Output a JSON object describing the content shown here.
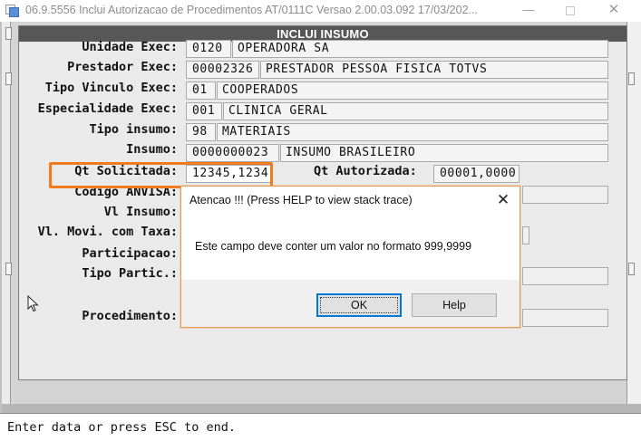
{
  "window": {
    "title": "06.9.5556    Inclui  Autorizacao de Procedimentos AT/0111C Versao 2.00.03.092 17/03/202...",
    "minimize_glyph": "—",
    "close_glyph": "✕",
    "icon": "app-window-icon"
  },
  "panel": {
    "header": "INCLUI INSUMO"
  },
  "form": {
    "unidade_exec": {
      "label": "Unidade Exec:",
      "code": "0120",
      "desc": "OPERADORA SA"
    },
    "prestador_exec": {
      "label": "Prestador Exec:",
      "code": "00002326",
      "desc": "PRESTADOR PESSOA FISICA TOTVS"
    },
    "tipo_vinculo_exec": {
      "label": "Tipo Vinculo Exec:",
      "code": "01",
      "desc": "COOPERADOS"
    },
    "especialidade_exec": {
      "label": "Especialidade Exec:",
      "code": "001",
      "desc": "CLINICA GERAL"
    },
    "tipo_insumo": {
      "label": "Tipo insumo:",
      "code": "98",
      "desc": "MATERIAIS"
    },
    "insumo": {
      "label": "Insumo:",
      "code": "0000000023",
      "desc": "INSUMO BRASILEIRO"
    },
    "qt_solicitada": {
      "label": "Qt Solicitada:",
      "value": "12345,1234"
    },
    "qt_autorizada": {
      "label": "Qt Autorizada:",
      "value": "00001,0000"
    },
    "codigo_anvisa": {
      "label": "Codigo ANVISA:"
    },
    "vl_insumo": {
      "label": "Vl Insumo:"
    },
    "vl_movi_taxa": {
      "label": "Vl. Movi. com Taxa:"
    },
    "participacao": {
      "label": "Participacao:"
    },
    "tipo_partic": {
      "label": "Tipo Partic.:"
    },
    "procedimento": {
      "label": "Procedimento:"
    }
  },
  "dialog": {
    "title": "Atencao !!!  (Press HELP to view stack trace)",
    "message": "Este campo deve conter um valor no formato 999,9999",
    "ok_label": "OK",
    "help_label": "Help",
    "close_glyph": "✕"
  },
  "status": {
    "text": "Enter data or press ESC to end."
  },
  "colors": {
    "highlight": "#f07b1e",
    "panel_header": "#575757",
    "ok_focus": "#0078d7"
  }
}
